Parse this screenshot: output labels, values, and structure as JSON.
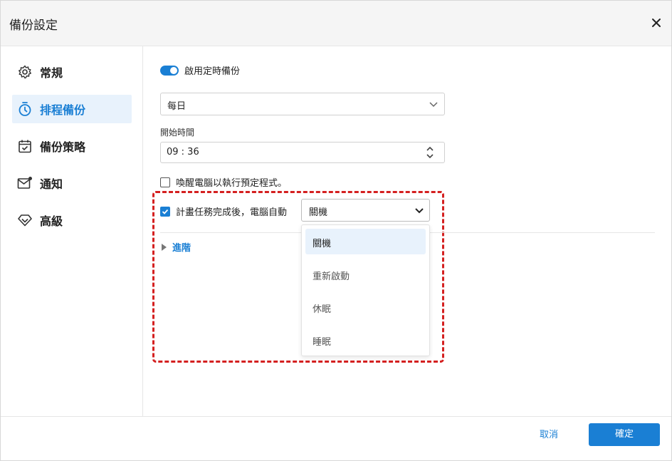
{
  "window": {
    "title": "備份設定"
  },
  "colors": {
    "accent": "#1a7fd4",
    "highlight_border": "#d42020",
    "active_bg": "#e8f2fc"
  },
  "sidebar": {
    "items": [
      {
        "label": "常規",
        "icon": "gear-icon",
        "active": false
      },
      {
        "label": "排程備份",
        "icon": "timer-icon",
        "active": true
      },
      {
        "label": "備份策略",
        "icon": "calendar-check-icon",
        "active": false
      },
      {
        "label": "通知",
        "icon": "mail-icon",
        "active": false
      },
      {
        "label": "高級",
        "icon": "diamond-icon",
        "active": false
      }
    ]
  },
  "schedule": {
    "enable_label": "啟用定時備份",
    "enabled": true,
    "frequency_value": "每日",
    "start_time_label": "開始時間",
    "start_time_value": "09 : 36",
    "wake_label": "喚醒電腦以執行預定程式。",
    "wake_checked": false,
    "after_label": "計畫任務完成後，電腦自動",
    "after_checked": true,
    "after_value": "關機",
    "after_options": [
      "關機",
      "重新啟動",
      "休眠",
      "睡眠"
    ],
    "advanced_label": "進階"
  },
  "footer": {
    "cancel_label": "取消",
    "ok_label": "確定"
  }
}
